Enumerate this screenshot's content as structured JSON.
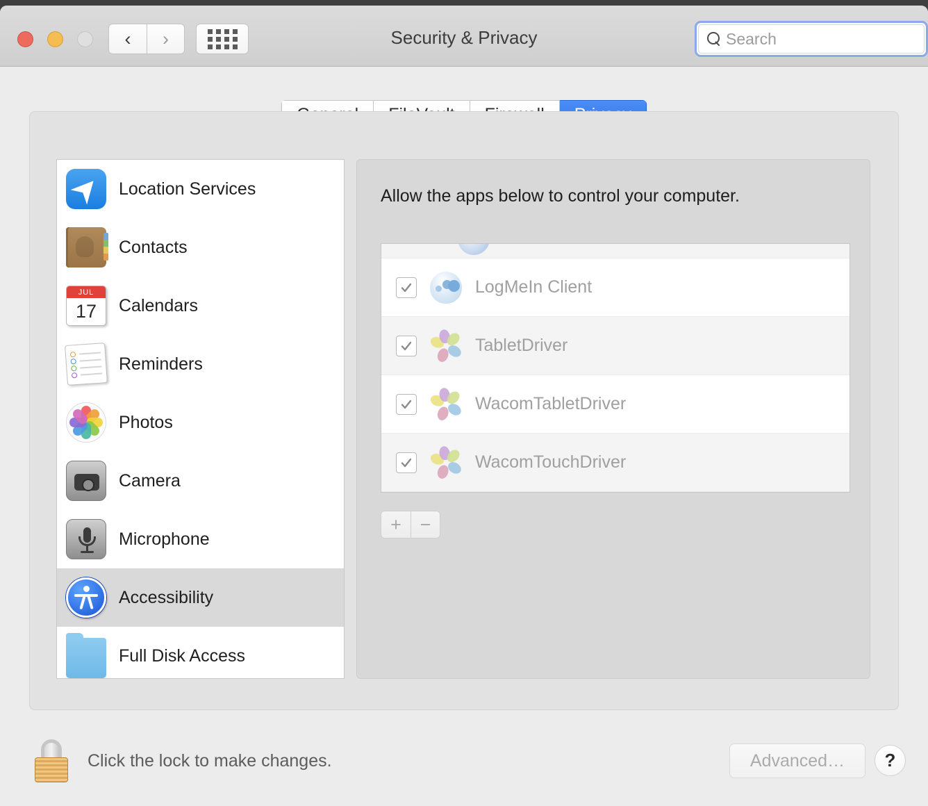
{
  "window": {
    "title": "Security & Privacy",
    "traffic_lights": [
      "close",
      "minimize",
      "zoom"
    ]
  },
  "toolbar": {
    "back_label": "‹",
    "forward_label": "›",
    "grid_icon": "grid-view-icon",
    "search": {
      "placeholder": "Search",
      "value": "",
      "icon": "search-icon",
      "focused": true
    }
  },
  "tabs": [
    {
      "label": "General",
      "active": false
    },
    {
      "label": "FileVault",
      "active": false
    },
    {
      "label": "Firewall",
      "active": false
    },
    {
      "label": "Privacy",
      "active": true
    }
  ],
  "sidebar": {
    "items": [
      {
        "label": "Location Services",
        "icon": "location-services-icon",
        "selected": false
      },
      {
        "label": "Contacts",
        "icon": "contacts-icon",
        "selected": false
      },
      {
        "label": "Calendars",
        "icon": "calendars-icon",
        "selected": false,
        "month": "JUL",
        "day": "17"
      },
      {
        "label": "Reminders",
        "icon": "reminders-icon",
        "selected": false
      },
      {
        "label": "Photos",
        "icon": "photos-icon",
        "selected": false
      },
      {
        "label": "Camera",
        "icon": "camera-icon",
        "selected": false
      },
      {
        "label": "Microphone",
        "icon": "microphone-icon",
        "selected": false
      },
      {
        "label": "Accessibility",
        "icon": "accessibility-icon",
        "selected": true
      },
      {
        "label": "Full Disk Access",
        "icon": "folder-icon",
        "selected": false
      }
    ]
  },
  "detail": {
    "description": "Allow the apps below to control your computer.",
    "apps": [
      {
        "name": "",
        "icon": "partial-app-icon",
        "checked": true,
        "partial": true
      },
      {
        "name": "LogMeIn Client",
        "icon": "logmein-icon",
        "checked": true,
        "partial": false
      },
      {
        "name": "TabletDriver",
        "icon": "wacom-icon",
        "checked": true,
        "partial": false
      },
      {
        "name": "WacomTabletDriver",
        "icon": "wacom-icon",
        "checked": true,
        "partial": false
      },
      {
        "name": "WacomTouchDriver",
        "icon": "wacom-icon",
        "checked": true,
        "partial": false
      }
    ],
    "add_label": "+",
    "remove_label": "−"
  },
  "footer": {
    "lock_icon": "lock-closed-icon",
    "lock_text": "Click the lock to make changes.",
    "advanced_label": "Advanced…",
    "advanced_disabled": true,
    "help_label": "?"
  },
  "colors": {
    "accent_blue": "#2f71ea",
    "window_bg": "#ececec",
    "panel_bg": "#e2e2e2",
    "list_bg": "#ffffff",
    "disabled_text": "#a0a0a0",
    "search_focus_ring": "#8aa9e8"
  }
}
